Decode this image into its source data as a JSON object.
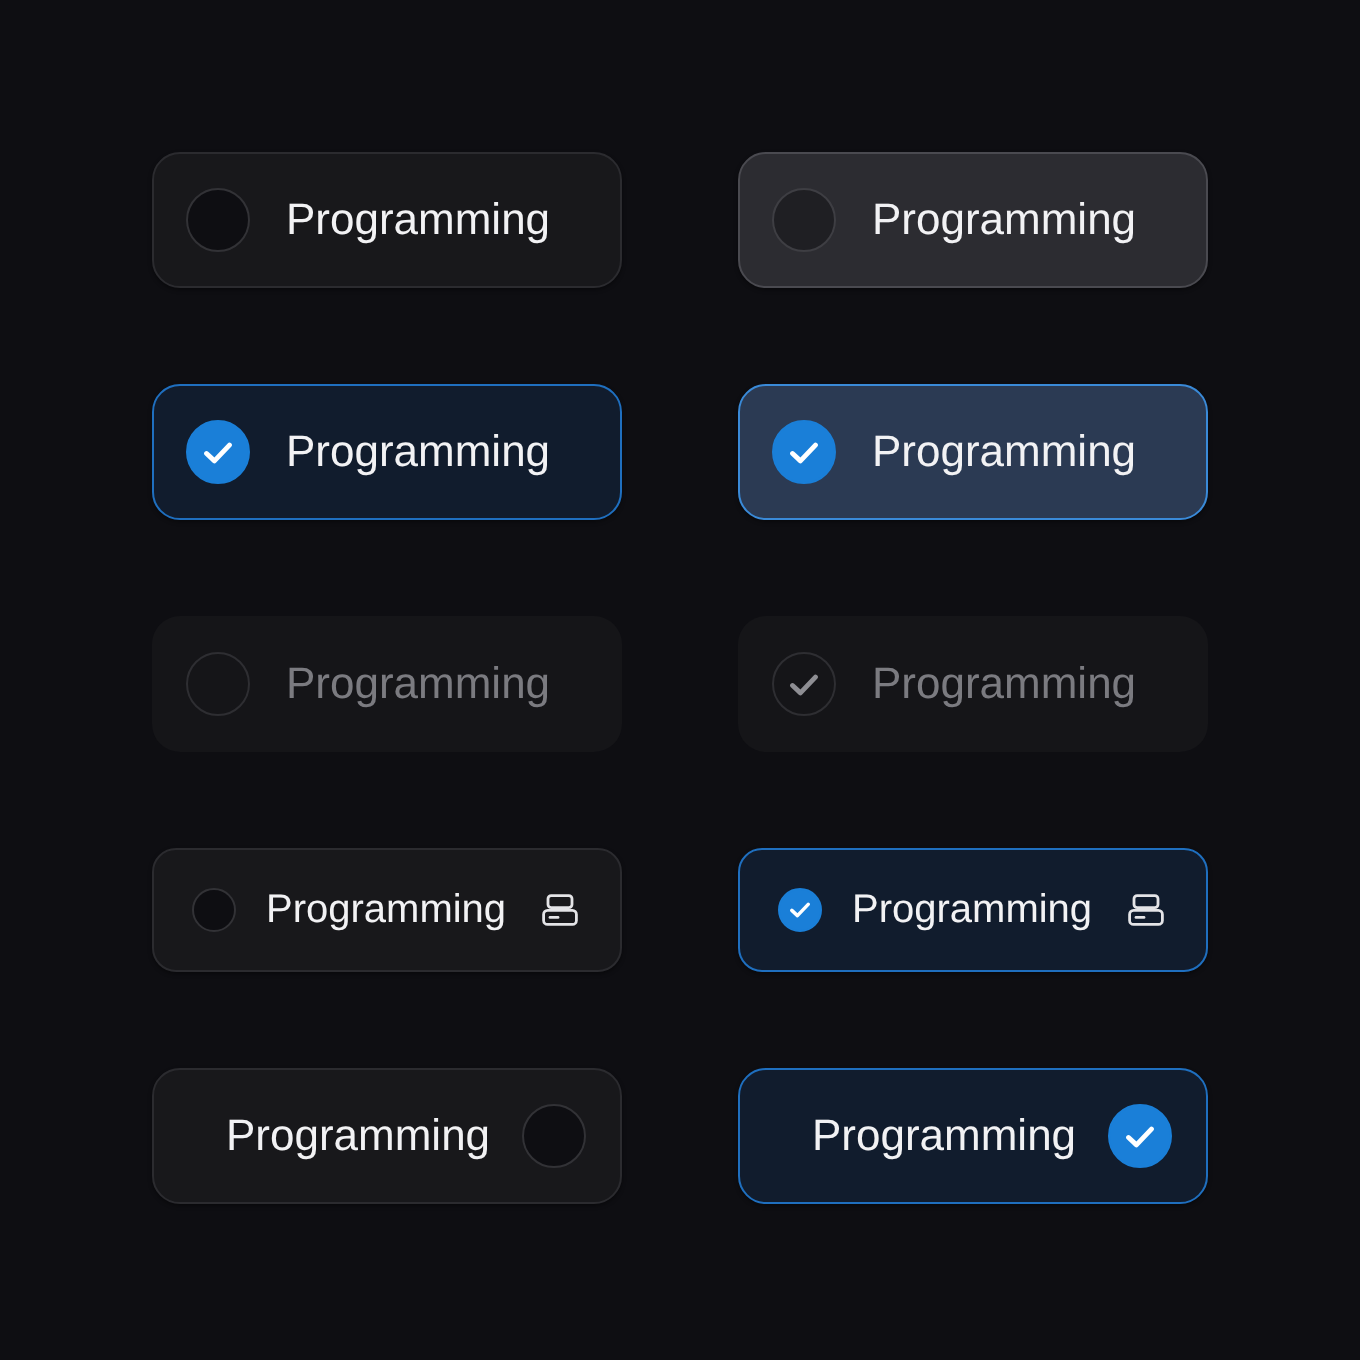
{
  "options": [
    {
      "kind": "large",
      "label": "Programming",
      "checked": false,
      "disabled": false,
      "hovered": false
    },
    {
      "kind": "large",
      "label": "Programming",
      "checked": false,
      "disabled": false,
      "hovered": true
    },
    {
      "kind": "large",
      "label": "Programming",
      "checked": true,
      "disabled": false,
      "hovered": false
    },
    {
      "kind": "large",
      "label": "Programming",
      "checked": true,
      "disabled": false,
      "hovered": true
    },
    {
      "kind": "large",
      "label": "Programming",
      "checked": false,
      "disabled": true,
      "hovered": false
    },
    {
      "kind": "large",
      "label": "Programming",
      "checked": true,
      "disabled": true,
      "hovered": false
    },
    {
      "kind": "compact",
      "label": "Programming",
      "checked": false,
      "disabled": false,
      "hovered": false
    },
    {
      "kind": "compact",
      "label": "Programming",
      "checked": true,
      "disabled": false,
      "hovered": false
    },
    {
      "kind": "trailing",
      "label": "Programming",
      "checked": false,
      "disabled": false,
      "hovered": false
    },
    {
      "kind": "trailing",
      "label": "Programming",
      "checked": true,
      "disabled": false,
      "hovered": false
    }
  ]
}
